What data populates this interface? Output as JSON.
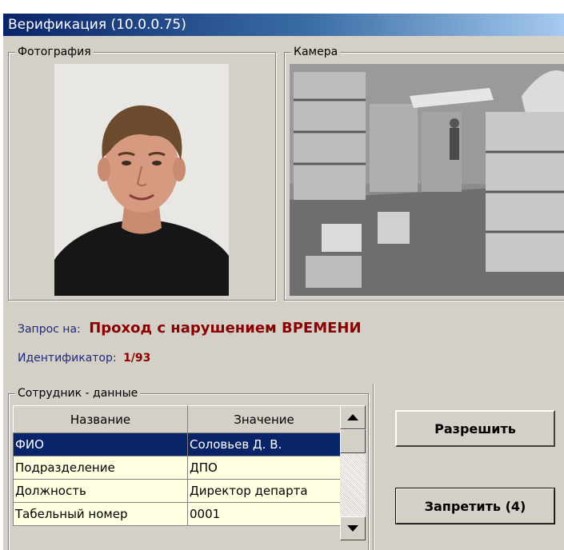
{
  "window": {
    "title": "Верификация (10.0.0.75)"
  },
  "photo_group": {
    "label": "Фотография"
  },
  "camera_group": {
    "label": "Камера"
  },
  "request": {
    "label": "Запрос на:",
    "value": "Проход с нарушением ВРЕМЕНИ",
    "identifier_label": "Идентификатор:",
    "identifier_value": "1/93"
  },
  "employee_group": {
    "label": "Сотрудник - данные",
    "columns": [
      "Название",
      "Значение"
    ],
    "rows": [
      {
        "name": "ФИО",
        "value": "Соловьев Д. В.",
        "selected": true
      },
      {
        "name": "Подразделение",
        "value": "ДПО"
      },
      {
        "name": "Должность",
        "value": "Директор департа"
      },
      {
        "name": "Табельный номер",
        "value": "0001"
      }
    ]
  },
  "buttons": {
    "allow": "Разрешить",
    "deny": "Запретить (4)"
  },
  "icons": {
    "scroll_up": "triangle-up-icon",
    "scroll_down": "triangle-down-icon"
  }
}
